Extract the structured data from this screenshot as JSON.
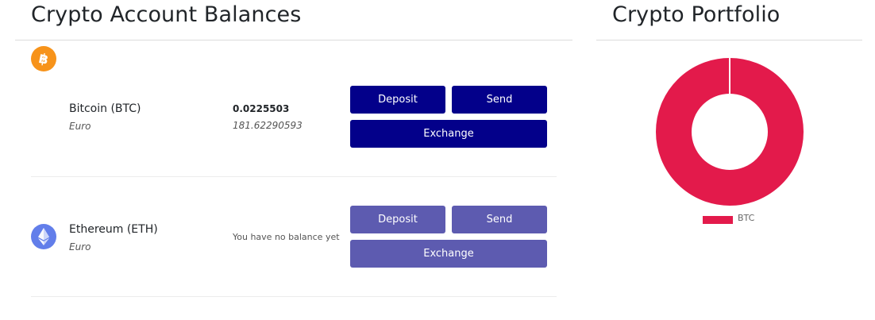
{
  "balances": {
    "title": "Crypto Account Balances",
    "rows": [
      {
        "name": "Bitcoin (BTC)",
        "currency": "Euro",
        "amount": "0.0225503",
        "amount_eur": "181.62290593",
        "buttons": {
          "deposit": "Deposit",
          "send": "Send",
          "exchange": "Exchange"
        }
      },
      {
        "name": "Ethereum (ETH)",
        "currency": "Euro",
        "no_balance": "You have no balance yet",
        "buttons": {
          "deposit": "Deposit",
          "send": "Send",
          "exchange": "Exchange"
        }
      }
    ]
  },
  "portfolio": {
    "title": "Crypto Portfolio",
    "chart_data": {
      "type": "pie",
      "variant": "doughnut",
      "labels": [
        "BTC"
      ],
      "values": [
        100
      ],
      "colors": [
        "#e31a4b"
      ],
      "legend": "bottom"
    }
  },
  "colors": {
    "btc_icon": "#f7931a",
    "eth_icon": "#627eea",
    "button_primary": "#03008a",
    "button_disabled": "#5d5bb0",
    "chart_slice": "#e31a4b"
  },
  "icons": {
    "btc": "bitcoin-icon",
    "eth": "ethereum-icon"
  }
}
